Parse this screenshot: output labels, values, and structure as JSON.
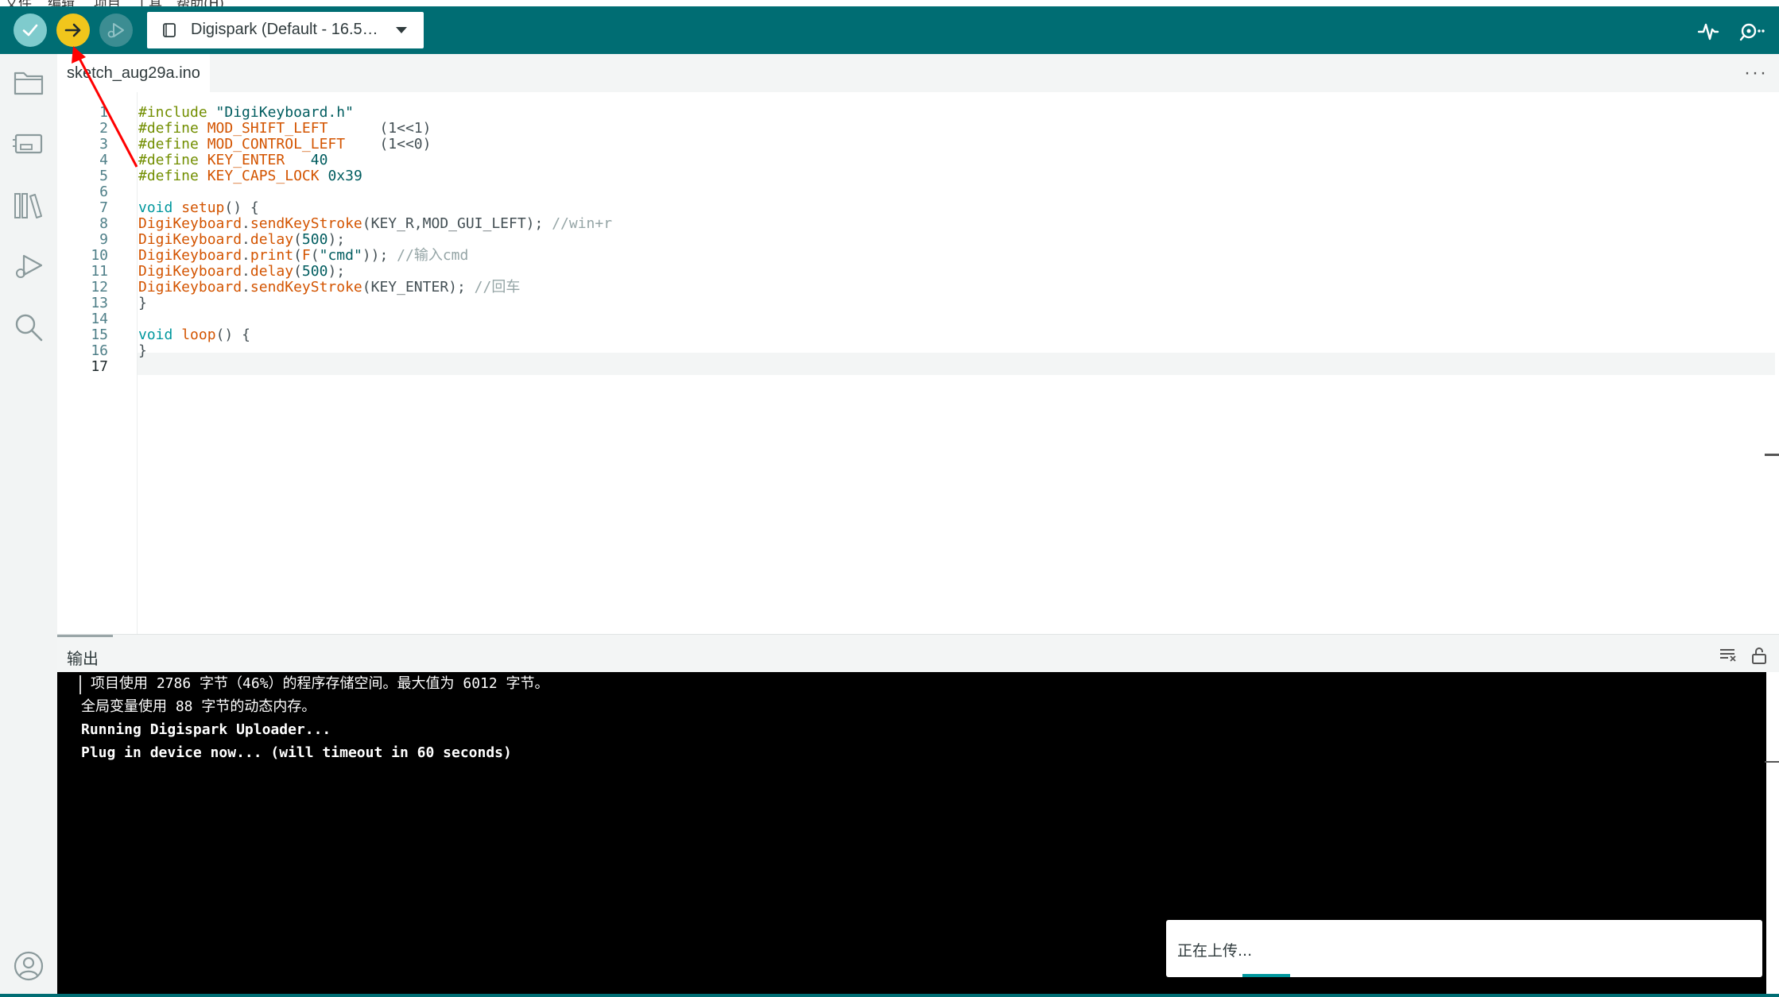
{
  "menubar": {
    "items": [
      "文件",
      "编辑",
      "项目",
      "工具",
      "帮助(H)"
    ]
  },
  "toolbar": {
    "verify_icon": "check-icon",
    "upload_icon": "arrow-right-icon",
    "debug_icon": "debug-icon",
    "board_label": "Digispark (Default - 16.5…",
    "colors": {
      "bar": "#006d73",
      "verify": "#7fcbcd",
      "upload": "#f1c61c",
      "debug": "#3c8d92"
    }
  },
  "sidebar": {
    "items": [
      "folder-icon",
      "board-manager-icon",
      "library-icon",
      "debug-icon",
      "search-icon"
    ],
    "account": "account-icon"
  },
  "tabs": [
    {
      "label": "sketch_aug29a.ino",
      "active": true
    }
  ],
  "tab_more": "···",
  "editor": {
    "line_numbers": [
      "1",
      "2",
      "3",
      "4",
      "5",
      "6",
      "7",
      "8",
      "9",
      "10",
      "11",
      "12",
      "13",
      "14",
      "15",
      "16",
      "17"
    ],
    "active_line": "17",
    "lines": [
      [
        {
          "t": "pp",
          "v": "#include "
        },
        {
          "t": "str",
          "v": "\"DigiKeyboard.h\""
        }
      ],
      [
        {
          "t": "pp",
          "v": "#define "
        },
        {
          "t": "fn",
          "v": "MOD_SHIFT_LEFT"
        },
        {
          "t": "tx",
          "v": "      (1<<1)"
        }
      ],
      [
        {
          "t": "pp",
          "v": "#define "
        },
        {
          "t": "fn",
          "v": "MOD_CONTROL_LEFT"
        },
        {
          "t": "tx",
          "v": "    (1<<0)"
        }
      ],
      [
        {
          "t": "pp",
          "v": "#define "
        },
        {
          "t": "fn",
          "v": "KEY_ENTER"
        },
        {
          "t": "tx",
          "v": "   "
        },
        {
          "t": "num",
          "v": "40"
        }
      ],
      [
        {
          "t": "pp",
          "v": "#define "
        },
        {
          "t": "fn",
          "v": "KEY_CAPS_LOCK"
        },
        {
          "t": "tx",
          "v": " "
        },
        {
          "t": "num",
          "v": "0x39"
        }
      ],
      [],
      [
        {
          "t": "kw",
          "v": "void"
        },
        {
          "t": "tx",
          "v": " "
        },
        {
          "t": "fn",
          "v": "setup"
        },
        {
          "t": "tx",
          "v": "() {"
        }
      ],
      [
        {
          "t": "fn",
          "v": "DigiKeyboard"
        },
        {
          "t": "tx",
          "v": "."
        },
        {
          "t": "fn",
          "v": "sendKeyStroke"
        },
        {
          "t": "tx",
          "v": "(KEY_R,MOD_GUI_LEFT); "
        },
        {
          "t": "cm",
          "v": "//win+r"
        }
      ],
      [
        {
          "t": "fn",
          "v": "DigiKeyboard"
        },
        {
          "t": "tx",
          "v": "."
        },
        {
          "t": "fn",
          "v": "delay"
        },
        {
          "t": "tx",
          "v": "("
        },
        {
          "t": "num",
          "v": "500"
        },
        {
          "t": "tx",
          "v": ");"
        }
      ],
      [
        {
          "t": "fn",
          "v": "DigiKeyboard"
        },
        {
          "t": "tx",
          "v": "."
        },
        {
          "t": "fn",
          "v": "print"
        },
        {
          "t": "tx",
          "v": "("
        },
        {
          "t": "fn",
          "v": "F"
        },
        {
          "t": "tx",
          "v": "("
        },
        {
          "t": "str",
          "v": "\"cmd\""
        },
        {
          "t": "tx",
          "v": ")); "
        },
        {
          "t": "cm",
          "v": "//输入cmd"
        }
      ],
      [
        {
          "t": "fn",
          "v": "DigiKeyboard"
        },
        {
          "t": "tx",
          "v": "."
        },
        {
          "t": "fn",
          "v": "delay"
        },
        {
          "t": "tx",
          "v": "("
        },
        {
          "t": "num",
          "v": "500"
        },
        {
          "t": "tx",
          "v": ");"
        }
      ],
      [
        {
          "t": "fn",
          "v": "DigiKeyboard"
        },
        {
          "t": "tx",
          "v": "."
        },
        {
          "t": "fn",
          "v": "sendKeyStroke"
        },
        {
          "t": "tx",
          "v": "(KEY_ENTER); "
        },
        {
          "t": "cm",
          "v": "//回车"
        }
      ],
      [
        {
          "t": "tx",
          "v": "}"
        }
      ],
      [],
      [
        {
          "t": "kw",
          "v": "void"
        },
        {
          "t": "tx",
          "v": " "
        },
        {
          "t": "fn",
          "v": "loop"
        },
        {
          "t": "tx",
          "v": "() {"
        }
      ],
      [
        {
          "t": "tx",
          "v": "}"
        }
      ],
      []
    ]
  },
  "output": {
    "title": "输出",
    "clear_icon": "clear-output-icon",
    "lock_icon": "unlock-icon",
    "lines": [
      "项目使用 2786 字节（46%）的程序存储空间。最大值为 6012 字节。",
      "全局变量使用 88 字节的动态内存。",
      "Running Digispark Uploader...",
      "Plug in device now... (will timeout in 60 seconds)"
    ]
  },
  "notification": {
    "text": "正在上传..."
  },
  "annotation": {
    "color": "#ff0000",
    "points_to": "upload-button"
  }
}
